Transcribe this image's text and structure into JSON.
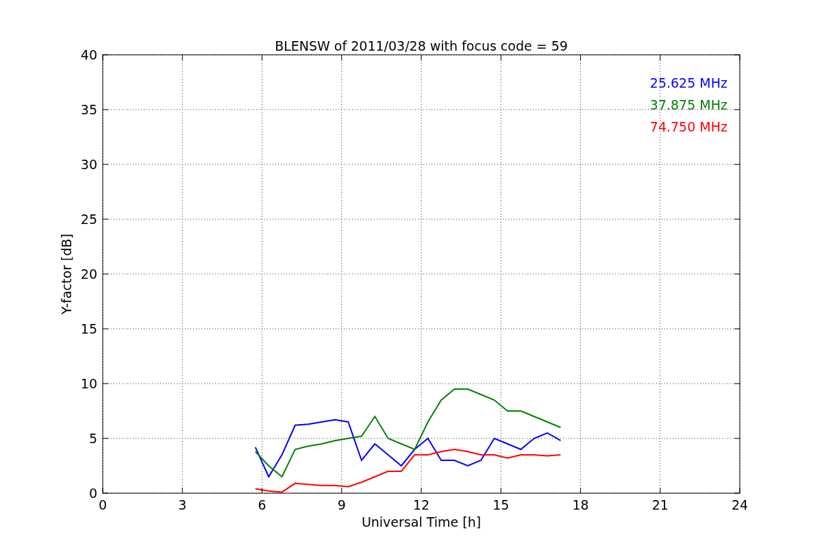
{
  "figure": {
    "chart_data": {
      "type": "line",
      "title": "BLENSW of 2011/03/28 with focus code = 59",
      "xlabel": "Universal Time [h]",
      "ylabel": "Y-factor [dB]",
      "x": [
        5.75,
        6.25,
        6.75,
        7.25,
        7.75,
        8.25,
        8.75,
        9.25,
        9.75,
        10.25,
        10.75,
        11.25,
        11.75,
        12.25,
        12.75,
        13.25,
        13.75,
        14.25,
        14.75,
        15.25,
        15.75,
        16.25,
        16.75,
        17.25
      ],
      "series": [
        {
          "name": "25.625 MHz",
          "color": "#0000ff",
          "values": [
            4.2,
            1.5,
            3.5,
            6.2,
            6.3,
            6.5,
            6.7,
            6.5,
            3.0,
            4.5,
            3.5,
            2.5,
            4.0,
            5.0,
            3.0,
            3.0,
            2.5,
            3.0,
            5.0,
            4.5,
            4.0,
            5.0,
            5.5,
            4.8
          ]
        },
        {
          "name": "37.875 MHz",
          "color": "#008000",
          "values": [
            3.8,
            2.5,
            1.5,
            4.0,
            4.3,
            4.5,
            4.8,
            5.0,
            5.2,
            7.0,
            5.0,
            4.5,
            4.0,
            6.5,
            8.5,
            9.5,
            9.5,
            9.0,
            8.5,
            7.5,
            7.5,
            7.0,
            6.5,
            6.0
          ]
        },
        {
          "name": "74.750 MHz",
          "color": "#ff0000",
          "values": [
            0.4,
            0.2,
            0.1,
            0.9,
            0.8,
            0.7,
            0.7,
            0.6,
            1.0,
            1.5,
            2.0,
            2.0,
            3.5,
            3.5,
            3.8,
            4.0,
            3.8,
            3.5,
            3.5,
            3.2,
            3.5,
            3.5,
            3.4,
            3.5
          ]
        }
      ],
      "xlim": [
        0,
        24
      ],
      "ylim": [
        0,
        40
      ],
      "xticks": [
        0,
        3,
        6,
        9,
        12,
        15,
        18,
        21,
        24
      ],
      "yticks": [
        0,
        5,
        10,
        15,
        20,
        25,
        30,
        35,
        40
      ],
      "grid": true
    }
  }
}
